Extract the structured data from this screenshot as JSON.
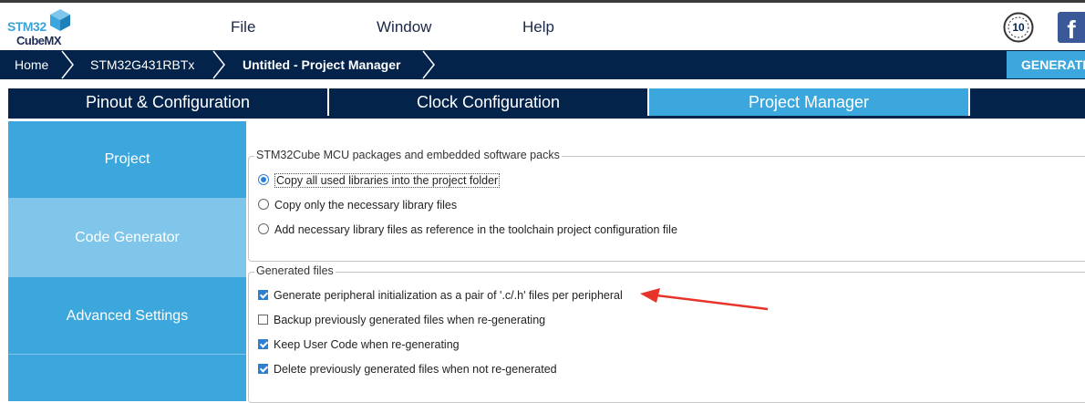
{
  "app": {
    "logo_line1": "STM32",
    "logo_line2": "CubeMX"
  },
  "menu": {
    "file": "File",
    "window": "Window",
    "help": "Help"
  },
  "badges": {
    "anniversary_text": "10",
    "facebook_letter": "f"
  },
  "breadcrumb": {
    "home": "Home",
    "device": "STM32G431RBTx",
    "current": "Untitled - Project Manager"
  },
  "generate_button": "GENERATE CODE",
  "tabs": [
    {
      "label": "Pinout & Configuration",
      "active": false
    },
    {
      "label": "Clock Configuration",
      "active": false
    },
    {
      "label": "Project Manager",
      "active": true
    },
    {
      "label": "",
      "active": false
    }
  ],
  "sidenav": {
    "items": [
      {
        "label": "Project",
        "selected": false
      },
      {
        "label": "Code Generator",
        "selected": true
      },
      {
        "label": "Advanced Settings",
        "selected": false
      }
    ]
  },
  "packages_group": {
    "title": "STM32Cube MCU packages and embedded software packs",
    "options": [
      {
        "label": "Copy all used libraries into the project folder",
        "selected": true
      },
      {
        "label": "Copy only the necessary library files",
        "selected": false
      },
      {
        "label": "Add necessary library files as reference in the toolchain project configuration file",
        "selected": false
      }
    ]
  },
  "generated_files_group": {
    "title": "Generated files",
    "options": [
      {
        "label": "Generate peripheral initialization as a pair of '.c/.h' files per peripheral",
        "checked": true
      },
      {
        "label": "Backup previously generated files when re-generating",
        "checked": false
      },
      {
        "label": "Keep User Code when re-generating",
        "checked": true
      },
      {
        "label": "Delete previously generated files when not re-generated",
        "checked": true
      }
    ]
  },
  "colors": {
    "navy": "#03234b",
    "accent_blue": "#3ca7dc",
    "selected_nav": "#7fc6ea",
    "annotation_arrow": "#e8332a"
  }
}
